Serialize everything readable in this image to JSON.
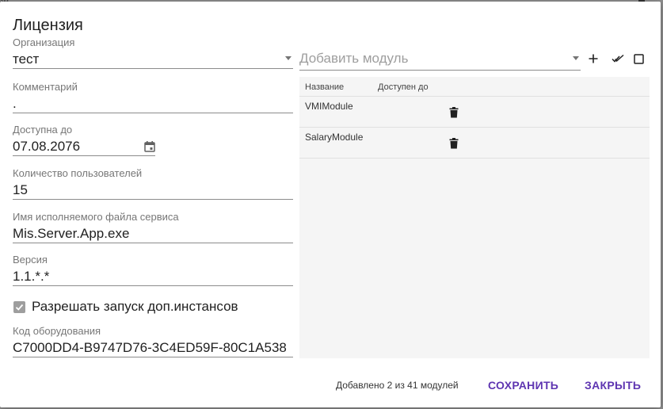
{
  "title": "Лицензия",
  "corner_text": "эм",
  "organization": {
    "label": "Организация",
    "value": "тест"
  },
  "comment": {
    "label": "Комментарий",
    "value": "."
  },
  "available_until": {
    "label": "Доступна до",
    "value": "07.08.2076"
  },
  "users_count": {
    "label": "Количество пользователей",
    "value": "15"
  },
  "service_file": {
    "label": "Имя исполняемого файла сервиса",
    "value": "Mis.Server.App.exe"
  },
  "version": {
    "label": "Версия",
    "value": "1.1.*.*"
  },
  "allow_instances": {
    "label": "Разрешать запуск доп.инстансов",
    "checked": true
  },
  "hardware_code": {
    "label": "Код оборудования",
    "value": "C7000DD4-B9747D76-3C4ED59F-80C1A538"
  },
  "add_module": {
    "placeholder": "Добавить модуль"
  },
  "icons": {
    "dropdown": "chevron-down-icon",
    "calendar": "calendar-icon",
    "add": "plus-icon",
    "select_all": "double-check-icon",
    "checkbox": "checkbox-icon",
    "delete": "trash-icon"
  },
  "table": {
    "columns": [
      "Название",
      "Доступен до"
    ],
    "rows": [
      {
        "name": "VMIModule",
        "until": ""
      },
      {
        "name": "SalaryModule",
        "until": ""
      }
    ]
  },
  "status": "Добавлено 2 из 41 модулей",
  "buttons": {
    "save": "СОХРАНИТЬ",
    "close": "ЗАКРЫТЬ"
  },
  "colors": {
    "accent": "#5e35b1",
    "table_bg": "#f5f5f5",
    "overlay": "#8f8f8f"
  }
}
